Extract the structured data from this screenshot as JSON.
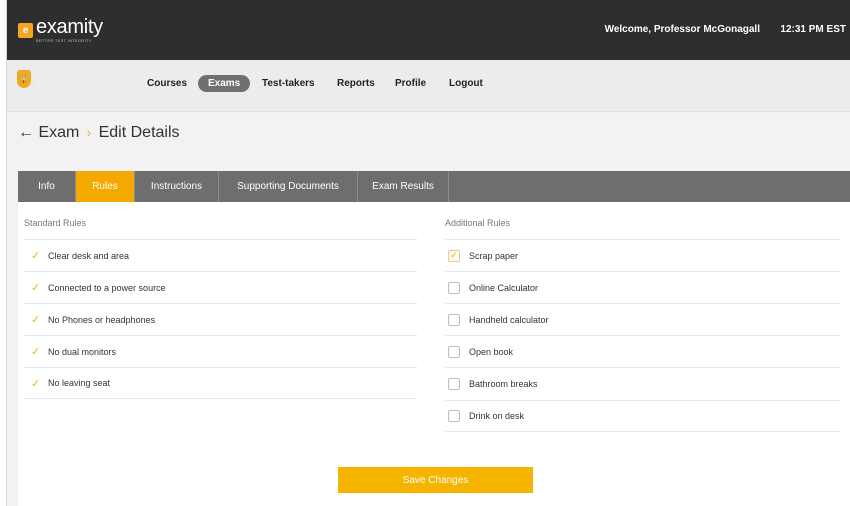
{
  "header": {
    "logo_badge": "e",
    "logo_word": "examity",
    "logo_tagline": "BETTER TEST INTEGRITY.",
    "welcome": "Welcome, Professor McGonagall",
    "time": "12:31 PM  EST"
  },
  "nav": {
    "brand": "Examity Courses",
    "items": [
      "Courses",
      "Exams",
      "Test-takers",
      "Reports",
      "Profile",
      "Logout"
    ],
    "active": "Exams"
  },
  "page": {
    "back_arrow": "←",
    "crumb_1": "Exam",
    "crumb_sep": "›",
    "crumb_2": "Edit Details"
  },
  "tabs": [
    "Info",
    "Rules",
    "Instructions",
    "Supporting Documents",
    "Exam Results"
  ],
  "active_tab": "Rules",
  "standard_rules": {
    "heading": "Standard Rules",
    "items": [
      "Clear desk and area",
      "Connected to a power source",
      "No Phones or headphones",
      "No dual monitors",
      "No leaving seat"
    ]
  },
  "additional_rules": {
    "heading": "Additional Rules",
    "items": [
      {
        "label": "Scrap paper",
        "checked": true
      },
      {
        "label": "Online Calculator",
        "checked": false
      },
      {
        "label": "Handheld calculator",
        "checked": false
      },
      {
        "label": "Open book",
        "checked": false
      },
      {
        "label": "Bathroom breaks",
        "checked": false
      },
      {
        "label": "Drink on desk",
        "checked": false
      }
    ]
  },
  "save_label": "Save Changes",
  "colors": {
    "accent": "#f5a800",
    "topbar": "#2e2e2e",
    "tabbar": "#6e6e6e"
  }
}
